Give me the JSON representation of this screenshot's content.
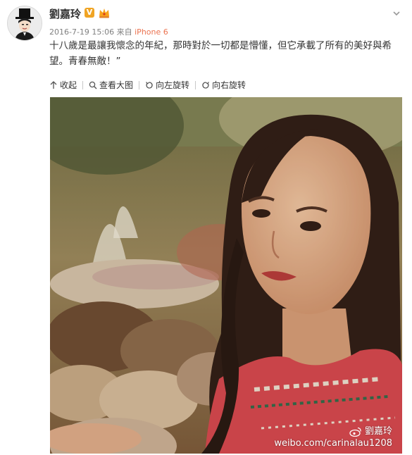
{
  "user": {
    "name": "劉嘉玲",
    "verified_mark": "V",
    "avatar_icon": "avatar-top-hat-icon"
  },
  "post": {
    "date": "2016-7-19 15:06",
    "source_prefix": "来自",
    "device": "iPhone 6",
    "text": "十八歲是最讓我懷念的年紀，那時對於一切都是懵懂，但它承載了所有的美好與希望。青春無敵！”"
  },
  "toolbar": {
    "collapse": "收起",
    "view_large": "查看大图",
    "rotate_left": "向左旋转",
    "rotate_right": "向右旋转"
  },
  "photo": {
    "watermark_name": "劉嘉玲",
    "watermark_url": "weibo.com/carinalau1208"
  },
  "colors": {
    "device_link": "#eb7350",
    "verified": "#f0a424",
    "meta": "#808080"
  }
}
